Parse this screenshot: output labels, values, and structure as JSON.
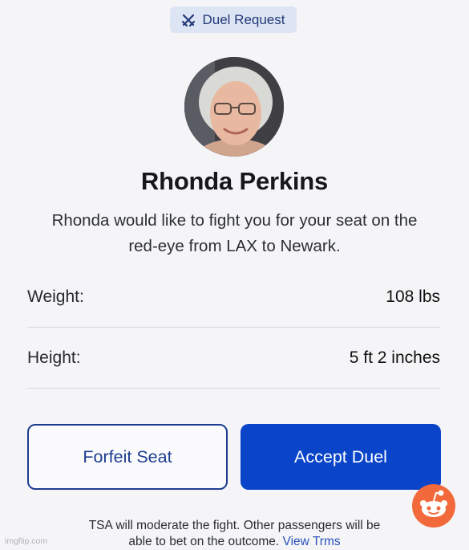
{
  "badge": {
    "icon": "crossed-swords-icon",
    "label": "Duel Request"
  },
  "profile": {
    "name": "Rhonda Perkins",
    "description": "Rhonda would like to fight you for your seat on the red-eye from LAX to Newark."
  },
  "stats": [
    {
      "label": "Weight:",
      "value": "108 lbs"
    },
    {
      "label": "Height:",
      "value": "5 ft 2 inches"
    }
  ],
  "actions": {
    "forfeit_label": "Forfeit Seat",
    "accept_label": "Accept Duel"
  },
  "footer": {
    "text": "TSA will moderate the fight. Other passengers will be able to bet on the outcome.",
    "link": "View Trms"
  },
  "watermark": "imgflip.com",
  "colors": {
    "accent": "#0a44c9",
    "badge_bg": "#dde4f3",
    "reddit_orange": "#f26a3b"
  }
}
